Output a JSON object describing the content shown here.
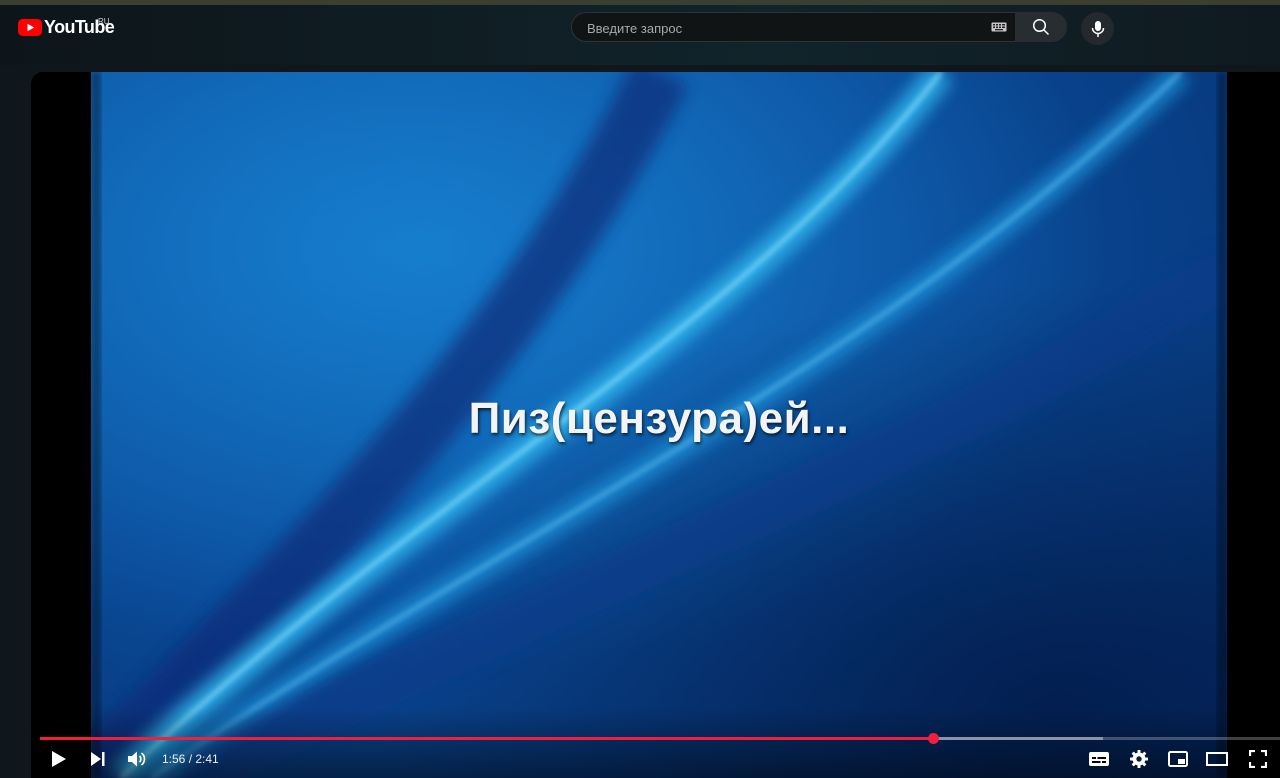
{
  "masthead": {
    "logo_text": "YouTube",
    "region": "RU",
    "search_placeholder": "Введите запрос"
  },
  "video": {
    "caption": "Пиз(цензура)ей...",
    "elapsed": "1:56",
    "duration": "2:41",
    "time_display": "1:56 / 2:41",
    "progress_fraction": 0.72,
    "buffered_fraction": 0.857
  },
  "icons": {
    "logo": "youtube-play-icon",
    "keyboard": "keyboard-icon",
    "search": "search-icon",
    "mic": "mic-icon",
    "play": "play-icon",
    "next": "next-icon",
    "volume": "volume-icon",
    "subtitles": "subtitles-icon",
    "settings": "gear-icon",
    "miniplayer": "miniplayer-icon",
    "theater": "theater-mode-icon",
    "fullscreen": "fullscreen-icon"
  },
  "colors": {
    "brand_red": "#ff0000",
    "progress_red": "#f0203d",
    "background": "#0f171c"
  }
}
